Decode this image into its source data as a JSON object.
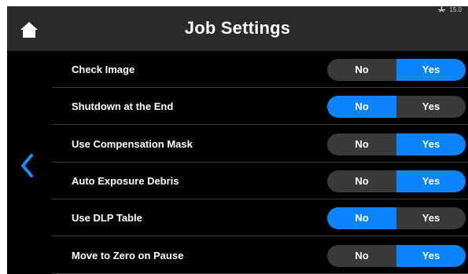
{
  "header": {
    "title": "Job Settings"
  },
  "status": {
    "value": "15.0",
    "icon": "usb-icon"
  },
  "colors": {
    "active": "#0a84ff",
    "inactive": "#3a3a3a",
    "header": "#2a2a2a",
    "background": "#000000"
  },
  "settings": [
    {
      "label": "Check Image",
      "no_label": "No",
      "yes_label": "Yes",
      "selected": "Yes"
    },
    {
      "label": "Shutdown at the End",
      "no_label": "No",
      "yes_label": "Yes",
      "selected": "No"
    },
    {
      "label": "Use Compensation Mask",
      "no_label": "No",
      "yes_label": "Yes",
      "selected": "Yes"
    },
    {
      "label": "Auto Exposure Debris",
      "no_label": "No",
      "yes_label": "Yes",
      "selected": "Yes"
    },
    {
      "label": "Use DLP Table",
      "no_label": "No",
      "yes_label": "Yes",
      "selected": "No"
    },
    {
      "label": "Move to Zero on Pause",
      "no_label": "No",
      "yes_label": "Yes",
      "selected": "Yes"
    }
  ]
}
